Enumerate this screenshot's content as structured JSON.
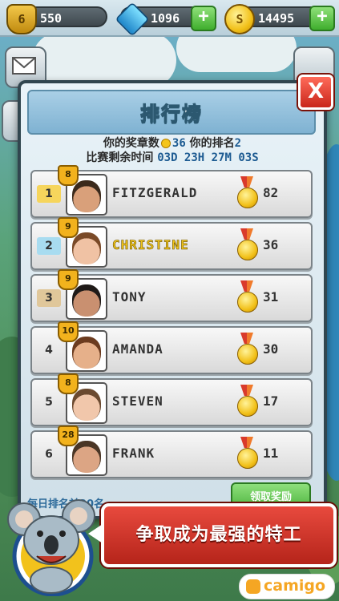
{
  "resources": {
    "level": {
      "icon": "shield-level-icon",
      "value": "550",
      "badge": "6"
    },
    "gems": {
      "icon": "diamond-icon",
      "value": "1096"
    },
    "coins": {
      "icon": "coin-icon",
      "value": "14495",
      "badge": "S"
    },
    "plus_label": "+"
  },
  "leaderboard": {
    "title": "排行榜",
    "medals_label": "你的奖章数",
    "medals_value": "36",
    "rank_label": "你的排名",
    "rank_value": "2",
    "time_label": "比赛剩余时间",
    "time_value": "03D 23H 27M 03S",
    "close_label": "X",
    "rows": [
      {
        "rank": "1",
        "level": "8",
        "name": "FITZGERALD",
        "score": "82",
        "rank_color": "#f6d55c",
        "skin": "#d9a07a",
        "hair": "#3b2a1c"
      },
      {
        "rank": "2",
        "level": "9",
        "name": "CHRISTINE",
        "score": "36",
        "rank_color": "#a8dcf0",
        "skin": "#f0c2a4",
        "hair": "#7a4a28"
      },
      {
        "rank": "3",
        "level": "9",
        "name": "TONY",
        "score": "31",
        "rank_color": "#e0c79a",
        "skin": "#c99070",
        "hair": "#1f1a18"
      },
      {
        "rank": "4",
        "level": "10",
        "name": "AMANDA",
        "score": "30",
        "rank_color": "transparent",
        "skin": "#e6b08a",
        "hair": "#6b3b1f"
      },
      {
        "rank": "5",
        "level": "8",
        "name": "STEVEN",
        "score": "17",
        "rank_color": "transparent",
        "skin": "#f1c7ab",
        "hair": "#6b4a30"
      },
      {
        "rank": "6",
        "level": "28",
        "name": "FRANK",
        "score": "11",
        "rank_color": "transparent",
        "skin": "#dca584",
        "hair": "#4a3626"
      }
    ],
    "bottom_text": "每日排名前20名…",
    "green_button": "领取奖励"
  },
  "promo": {
    "text": "争取成为最强的特工",
    "brand": "camigo"
  },
  "colors": {
    "accent_red": "#d93a2b",
    "medal_gold": "#f2c11a",
    "highlight_blue": "#1d5b92"
  }
}
